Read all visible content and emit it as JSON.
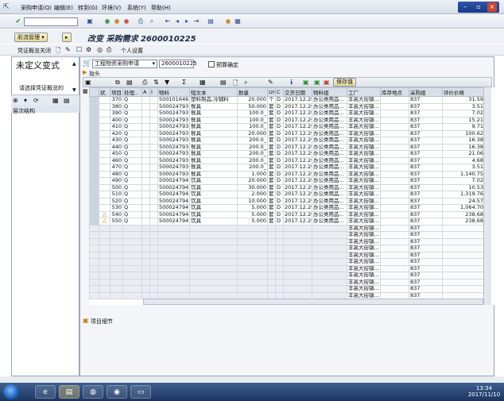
{
  "menu": {
    "items": [
      "采购申请(Q)",
      "编辑(E)",
      "转到(G)",
      "环境(V)",
      "系统(Y)",
      "帮助(H)"
    ]
  },
  "window_controls": {
    "minimize": "–",
    "restore": "▫",
    "close": "×"
  },
  "title": "改变 采购需求 2600010225",
  "toolbar2": {
    "doc_overview": "凭证概览关闭",
    "personal_settings": "个人设置",
    "menu_button": "彩流管理",
    "other": "▸"
  },
  "left_panel": {
    "title": "未定义变式",
    "prompt": "请选择凭证概览的",
    "structure": "层次结构"
  },
  "main": {
    "doc_type": "工程物资采购申请",
    "doc_number": "2600010225",
    "checkbox_label": "预算确定",
    "header_label": "抬头",
    "hold_button": "保存值",
    "items_detail": "项目细节"
  },
  "table": {
    "columns": [
      "",
      "状.",
      "项目",
      "处理..",
      "A",
      "I",
      "物料",
      "短文本",
      "数量",
      "Un",
      "C",
      "交货日期",
      "物料组",
      "工厂",
      "库存地点",
      "采购组",
      "评价价格"
    ],
    "rows": [
      {
        "status": "",
        "item": "370",
        "proc": "Q",
        "material": "500101646",
        "text": "塑料制品,冷辅料",
        "qty": "20.000",
        "unit": "个",
        "c": "D",
        "date": "2017.12.29",
        "group": "办公类用品...",
        "plant": "丰高大街镇...",
        "porg": "837",
        "price": "31.59"
      },
      {
        "status": "",
        "item": "380",
        "proc": "Q",
        "material": "500024793",
        "text": "餐具",
        "qty": "50.000",
        "unit": "套",
        "c": "D",
        "date": "2017.12.29",
        "group": "办公类用品...",
        "plant": "丰高大街镇...",
        "porg": "837",
        "price": "3.51"
      },
      {
        "status": "",
        "item": "390",
        "proc": "Q",
        "material": "500024793",
        "text": "餐具",
        "qty": "100.0_",
        "unit": "套",
        "c": "D",
        "date": "2017.12.29",
        "group": "办公类用品...",
        "plant": "丰高大街镇...",
        "porg": "837",
        "price": "7.02"
      },
      {
        "status": "",
        "item": "400",
        "proc": "Q",
        "material": "500024793",
        "text": "餐具",
        "qty": "100.0_",
        "unit": "套",
        "c": "D",
        "date": "2017.12.29",
        "group": "办公类用品...",
        "plant": "丰高大街镇...",
        "porg": "837",
        "price": "15.21"
      },
      {
        "status": "",
        "item": "410",
        "proc": "Q",
        "material": "500024793",
        "text": "餐具",
        "qty": "100.0_",
        "unit": "套",
        "c": "D",
        "date": "2017.12.29",
        "group": "办公类用品...",
        "plant": "丰高大街镇...",
        "porg": "837",
        "price": "9.71"
      },
      {
        "status": "",
        "item": "420",
        "proc": "Q",
        "material": "500024793",
        "text": "餐具",
        "qty": "20.000",
        "unit": "套",
        "c": "D",
        "date": "2017.12.29",
        "group": "办公类用品...",
        "plant": "丰高大街镇...",
        "porg": "837",
        "price": "100.62"
      },
      {
        "status": "",
        "item": "430",
        "proc": "Q",
        "material": "500024793",
        "text": "餐具",
        "qty": "200.0_",
        "unit": "套",
        "c": "D",
        "date": "2017.12.29",
        "group": "办公类用品...",
        "plant": "丰高大街镇...",
        "porg": "837",
        "price": "16.38"
      },
      {
        "status": "",
        "item": "440",
        "proc": "Q",
        "material": "500024793",
        "text": "餐具",
        "qty": "200.0_",
        "unit": "套",
        "c": "D",
        "date": "2017.12.29",
        "group": "办公类用品...",
        "plant": "丰高大街镇...",
        "porg": "837",
        "price": "16.38"
      },
      {
        "status": "",
        "item": "450",
        "proc": "Q",
        "material": "500024793",
        "text": "餐具",
        "qty": "200.0_",
        "unit": "套",
        "c": "D",
        "date": "2017.12.29",
        "group": "办公类用品...",
        "plant": "丰高大街镇...",
        "porg": "837",
        "price": "21.06"
      },
      {
        "status": "",
        "item": "460",
        "proc": "Q",
        "material": "500024793",
        "text": "餐具",
        "qty": "200.0_",
        "unit": "套",
        "c": "D",
        "date": "2017.12.29",
        "group": "办公类用品...",
        "plant": "丰高大街镇...",
        "porg": "837",
        "price": "4.68"
      },
      {
        "status": "",
        "item": "470",
        "proc": "Q",
        "material": "500024793",
        "text": "餐具",
        "qty": "200.0_",
        "unit": "套",
        "c": "D",
        "date": "2017.12.29",
        "group": "办公类用品...",
        "plant": "丰高大街镇...",
        "porg": "837",
        "price": "3.51"
      },
      {
        "status": "",
        "item": "480",
        "proc": "Q",
        "material": "500024793",
        "text": "餐具",
        "qty": "1.000",
        "unit": "套",
        "c": "D",
        "date": "2017.12.29",
        "group": "办公类用品...",
        "plant": "丰高大街镇...",
        "porg": "837",
        "price": "1,140.75"
      },
      {
        "status": "",
        "item": "490",
        "proc": "Q",
        "material": "500024794",
        "text": "饮具",
        "qty": "20.000",
        "unit": "套",
        "c": "D",
        "date": "2017.12.29",
        "group": "办公类用品...",
        "plant": "丰高大街镇...",
        "porg": "837",
        "price": "7.02"
      },
      {
        "status": "",
        "item": "500",
        "proc": "Q",
        "material": "500024794",
        "text": "饮具",
        "qty": "30.000",
        "unit": "套",
        "c": "D",
        "date": "2017.12.29",
        "group": "办公类用品...",
        "plant": "丰高大街镇...",
        "porg": "837",
        "price": "10.53"
      },
      {
        "status": "",
        "item": "510",
        "proc": "Q",
        "material": "500024794",
        "text": "饮具",
        "qty": "2.000",
        "unit": "套",
        "c": "D",
        "date": "2017.12.29",
        "group": "办公类用品...",
        "plant": "丰高大街镇...",
        "porg": "837",
        "price": "1,319.76"
      },
      {
        "status": "",
        "item": "520",
        "proc": "Q",
        "material": "500024794",
        "text": "饮具",
        "qty": "10.000",
        "unit": "套",
        "c": "D",
        "date": "2017.12.29",
        "group": "办公类用品...",
        "plant": "丰高大街镇...",
        "porg": "837",
        "price": "24.57"
      },
      {
        "status": "",
        "item": "530",
        "proc": "Q",
        "material": "500024794",
        "text": "饮具",
        "qty": "5.000",
        "unit": "套",
        "c": "D",
        "date": "2017.12.29",
        "group": "办公类用品...",
        "plant": "丰高大街镇...",
        "porg": "837",
        "price": "1,064.70"
      },
      {
        "status": "△",
        "item": "540",
        "proc": "Q",
        "material": "500024794",
        "text": "饮具",
        "qty": "5.000",
        "unit": "套",
        "c": "D",
        "date": "2017.12.29",
        "group": "办公类用品...",
        "plant": "丰高大街镇...",
        "porg": "837",
        "price": "238.68"
      },
      {
        "status": "△",
        "item": "550",
        "proc": "Q",
        "material": "500024794",
        "text": "饮具",
        "qty": "5.000",
        "unit": "套",
        "c": "D",
        "date": "2017.12.29",
        "group": "办公类用品...",
        "plant": "丰高大街镇...",
        "porg": "837",
        "price": "238.68"
      }
    ],
    "empty_row_plant": "丰高大街镇...",
    "empty_row_porg": "837",
    "empty_row_count": 11
  },
  "taskbar": {
    "time": "13:34",
    "date": "2017/11/10"
  },
  "colors": {
    "accent": "#2f55a8",
    "warning": "#b08a00"
  }
}
